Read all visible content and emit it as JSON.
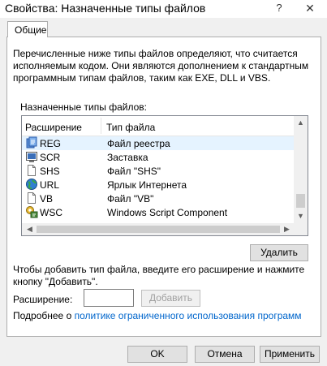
{
  "window": {
    "title": "Свойства: Назначенные типы файлов",
    "help_glyph": "?",
    "close_glyph": "✕"
  },
  "tabs": [
    {
      "label": "Общие"
    }
  ],
  "description": "Перечисленные ниже типы файлов определяют, что считается исполняемым кодом. Они являются дополнением к стандартным программным типам файлов, таким как EXE, DLL и VBS.",
  "list": {
    "label": "Назначенные типы файлов:",
    "columns": {
      "extension": "Расширение",
      "file_type": "Тип файла"
    },
    "rows": [
      {
        "ext": "REG",
        "type": "Файл реестра",
        "icon": "registry-icon"
      },
      {
        "ext": "SCR",
        "type": "Заставка",
        "icon": "screensaver-icon"
      },
      {
        "ext": "SHS",
        "type": "Файл \"SHS\"",
        "icon": "file-icon"
      },
      {
        "ext": "URL",
        "type": "Ярлык Интернета",
        "icon": "globe-icon"
      },
      {
        "ext": "VB",
        "type": "Файл \"VB\"",
        "icon": "file-icon"
      },
      {
        "ext": "WSC",
        "type": "Windows Script Component",
        "icon": "script-component-icon"
      }
    ]
  },
  "buttons": {
    "delete": "Удалить",
    "add": "Добавить",
    "ok": "OK",
    "cancel": "Отмена",
    "apply": "Применить"
  },
  "hint": "Чтобы добавить тип файла, введите его расширение и нажмите кнопку \"Добавить\".",
  "extension_field": {
    "label": "Расширение:",
    "value": ""
  },
  "more_info": {
    "prefix": "Подробнее о ",
    "link": "политике ограниченного использования программ"
  },
  "colors": {
    "link": "#0066cc",
    "selected_row": "#e5f3ff",
    "dialog_bg": "#f0f0f0"
  }
}
